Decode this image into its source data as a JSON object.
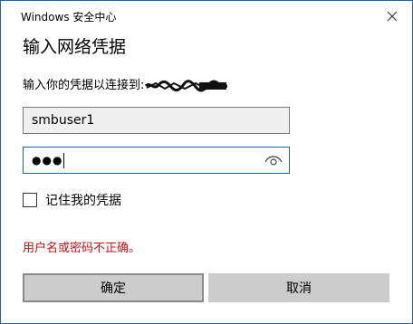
{
  "window": {
    "title": "Windows 安全中心",
    "close_icon": "close-icon"
  },
  "dialog": {
    "heading": "输入网络凭据",
    "prompt": "输入你的凭据以连接到:",
    "redacted_host_icon": "redaction-scribble"
  },
  "form": {
    "username_value": "smbuser1",
    "password_mask": "●●●",
    "reveal_icon": "eye-icon",
    "remember_label": "记住我的凭据",
    "remember_checked": false
  },
  "error": {
    "message": "用户名或密码不正确。",
    "color": "#c41010"
  },
  "buttons": {
    "ok_label": "确定",
    "cancel_label": "取消"
  },
  "colors": {
    "border_accent": "#1f62a6",
    "button_bg": "#cccccc"
  }
}
